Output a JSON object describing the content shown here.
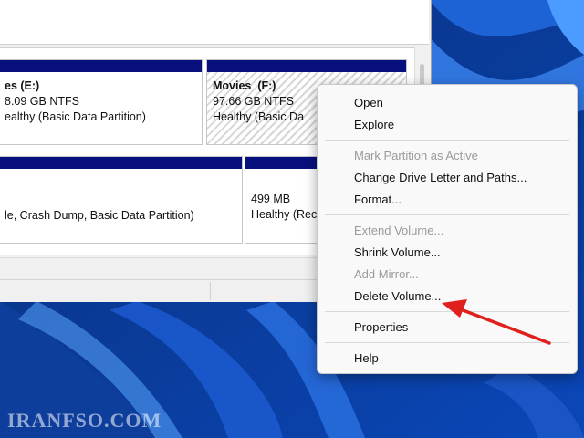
{
  "partitions": [
    {
      "name_prefix": "es",
      "drive": "(E:)",
      "size": "8.09 GB NTFS",
      "status": "ealthy (Basic Data Partition)"
    },
    {
      "name": "Movies",
      "drive": "(F:)",
      "size": "97.66 GB NTFS",
      "status": "Healthy (Basic Da"
    },
    {
      "status": "le, Crash Dump, Basic Data Partition)"
    },
    {
      "size": "499 MB",
      "status": "Healthy (Rec"
    }
  ],
  "context_menu": {
    "items": [
      {
        "label": "Open",
        "enabled": true
      },
      {
        "label": "Explore",
        "enabled": true
      },
      {
        "label": "Mark Partition as Active",
        "enabled": false
      },
      {
        "label": "Change Drive Letter and Paths...",
        "enabled": true
      },
      {
        "label": "Format...",
        "enabled": true
      },
      {
        "label": "Extend Volume...",
        "enabled": false
      },
      {
        "label": "Shrink Volume...",
        "enabled": true
      },
      {
        "label": "Add Mirror...",
        "enabled": false
      },
      {
        "label": "Delete Volume...",
        "enabled": true
      },
      {
        "label": "Properties",
        "enabled": true
      },
      {
        "label": "Help",
        "enabled": true
      }
    ]
  },
  "annotation": {
    "icon": "red-arrow-icon",
    "color": "#e0201c"
  },
  "watermark": "IRANFSO.COM",
  "colors": {
    "partition_bar": "#08107e",
    "wallpaper": "#0b3a8c"
  }
}
